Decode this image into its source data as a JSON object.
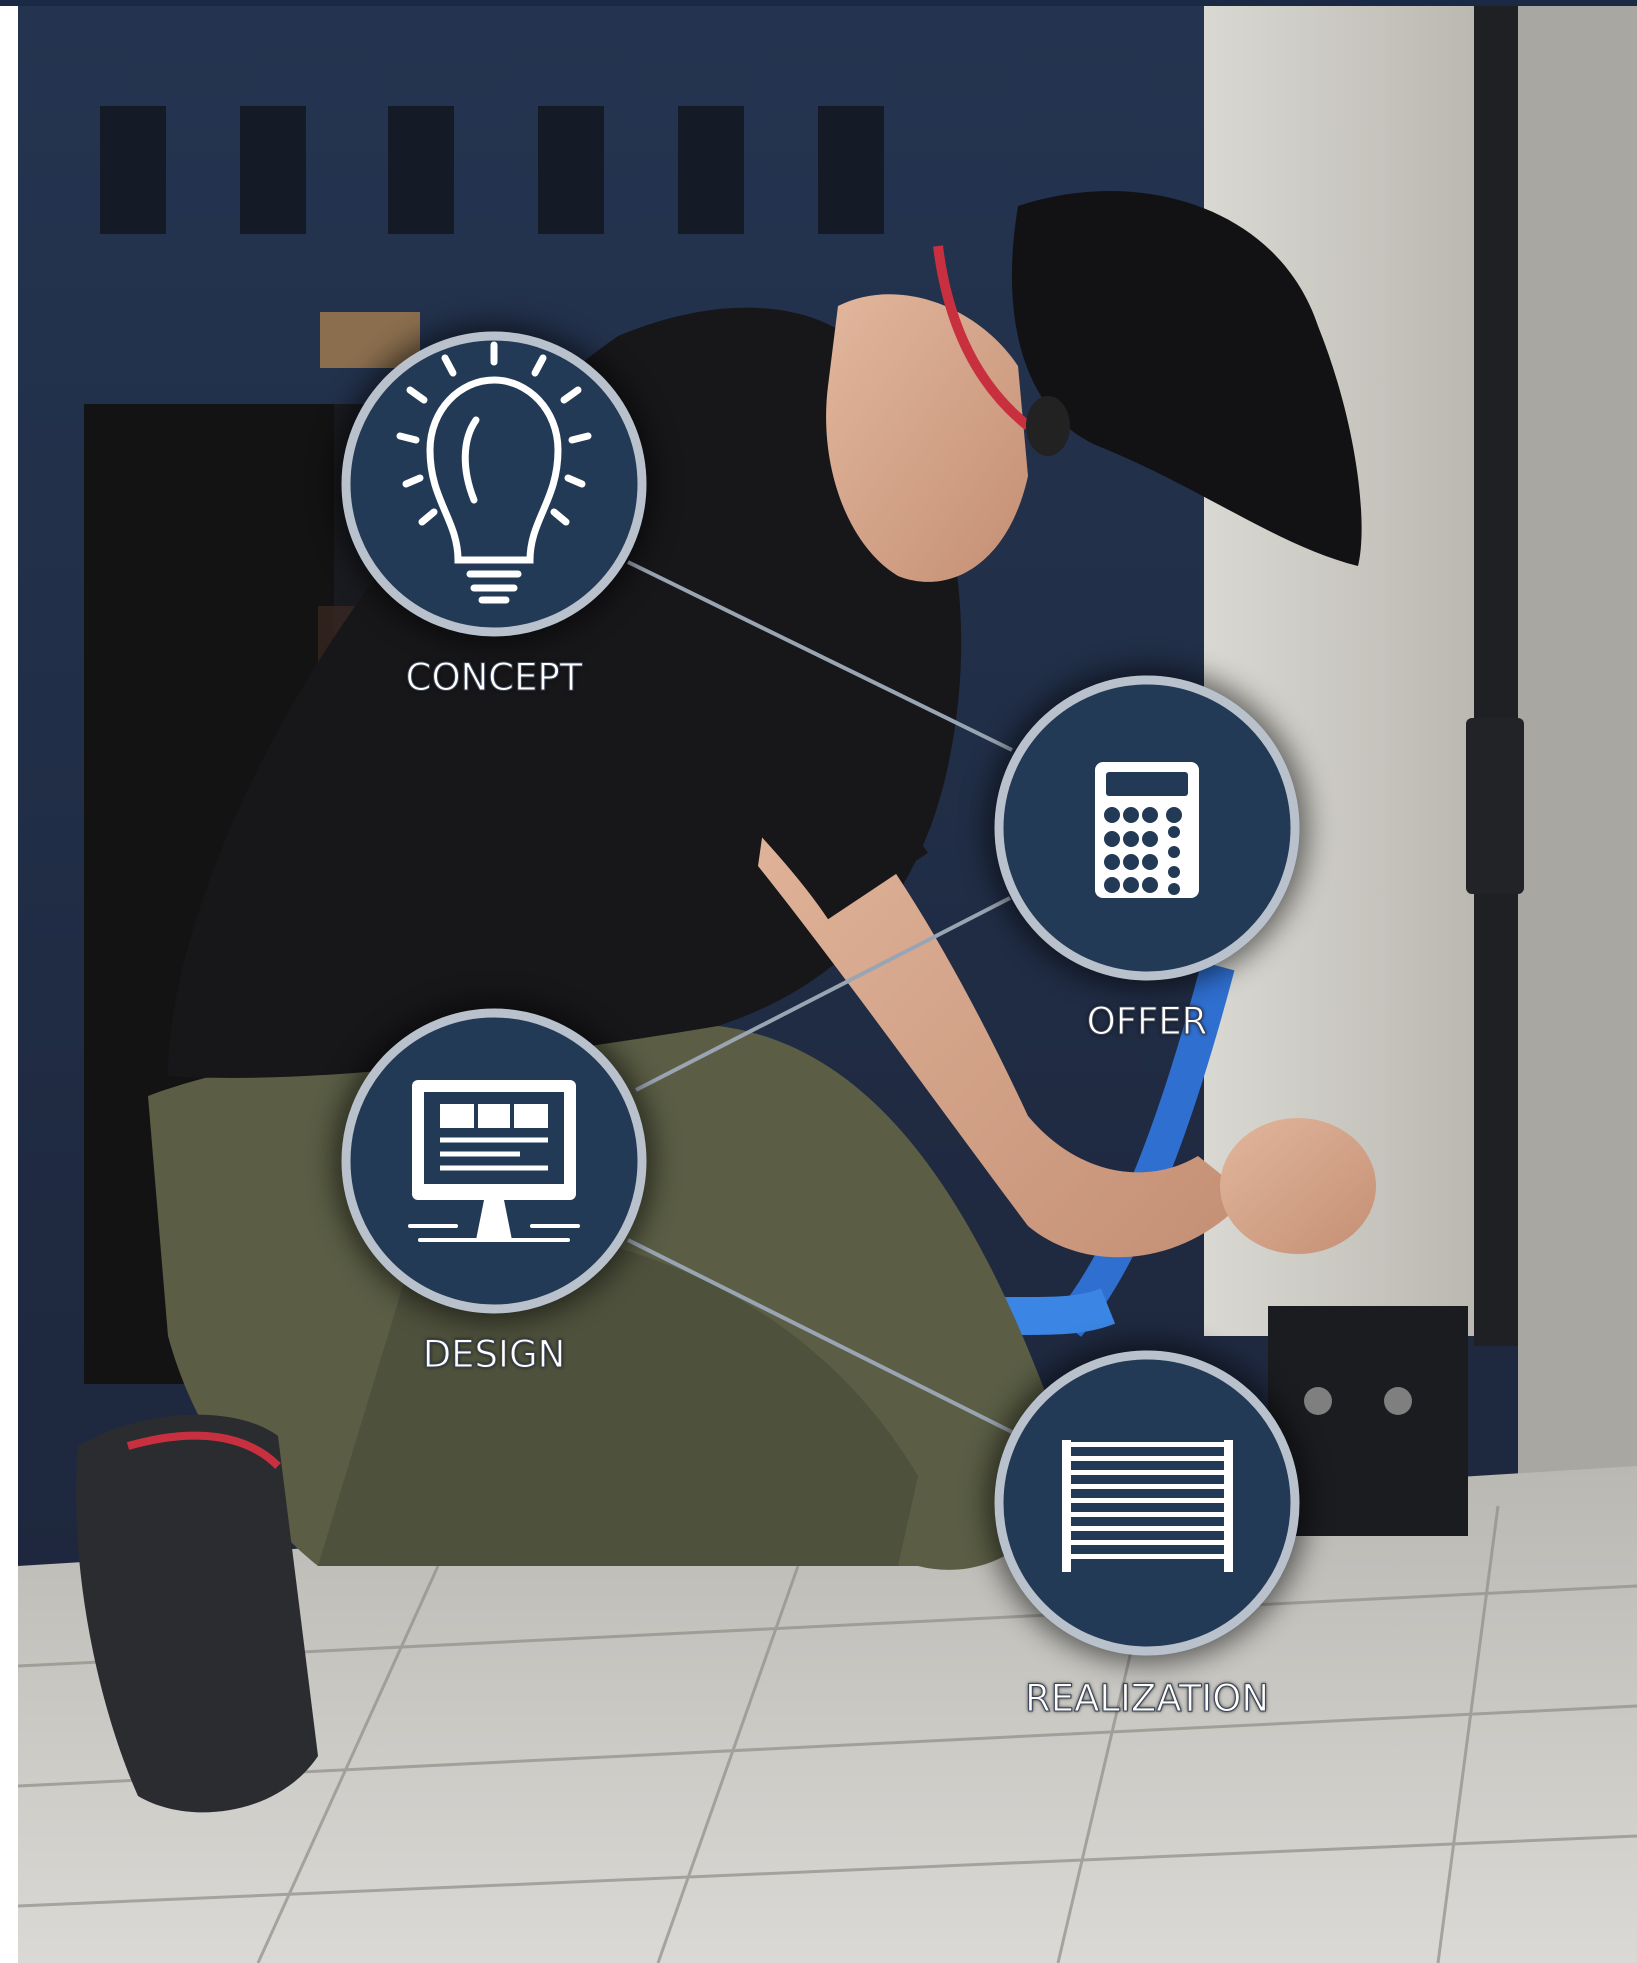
{
  "steps": [
    {
      "label": "CONCEPT",
      "icon": "lightbulb-icon"
    },
    {
      "label": "OFFER",
      "icon": "calculator-icon"
    },
    {
      "label": "DESIGN",
      "icon": "monitor-icon"
    },
    {
      "label": "REALIZATION",
      "icon": "gate-icon"
    }
  ],
  "colors": {
    "circle_fill": "#233a56",
    "circle_ring": "#b9c2cc",
    "connector": "#9aa5b3",
    "top_bar": "#1a2a44"
  }
}
